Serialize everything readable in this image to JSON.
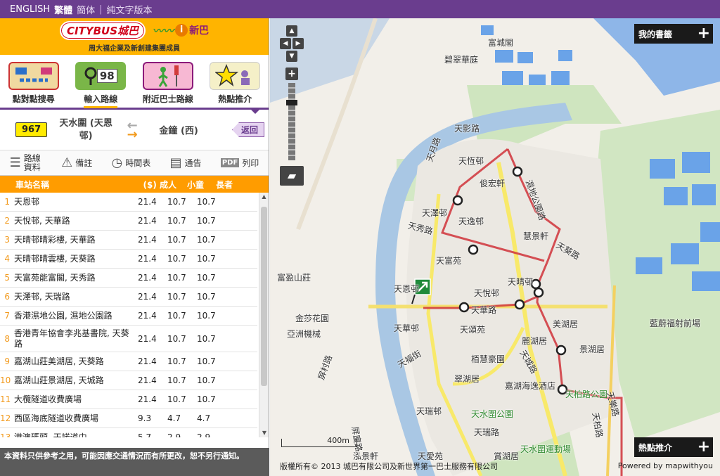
{
  "langbar": {
    "english": "ENGLISH",
    "trad": "繁體",
    "simp": "簡体",
    "text_version": "純文字版本"
  },
  "logo": {
    "citybus": "CITYBUS城巴",
    "firstbus": "新巴",
    "tagline": "周大福企業及新創建集團成員"
  },
  "tabs": [
    {
      "label": "點對點搜尋"
    },
    {
      "label": "輸入路線",
      "number": "98"
    },
    {
      "label": "附近巴士路線"
    },
    {
      "label": "熱點推介"
    }
  ],
  "route": {
    "number": "967",
    "from": "天水圍 (天恩邨)",
    "to": "金鐘 (西)",
    "back": "返回"
  },
  "toolbar": {
    "info": "路線資料",
    "remarks": "備註",
    "timetable": "時間表",
    "notice": "通告",
    "print": "列印"
  },
  "table": {
    "headers": {
      "stop": "車站名稱",
      "adult": "($) 成人",
      "child": "小童",
      "senior": "長者"
    },
    "rows": [
      {
        "n": "1",
        "name": "天恩邨",
        "a": "21.4",
        "b": "10.7",
        "c": "10.7"
      },
      {
        "n": "2",
        "name": "天悅邨, 天華路",
        "a": "21.4",
        "b": "10.7",
        "c": "10.7"
      },
      {
        "n": "3",
        "name": "天晴邨晴彩樓, 天華路",
        "a": "21.4",
        "b": "10.7",
        "c": "10.7"
      },
      {
        "n": "4",
        "name": "天晴邨晴雲樓, 天葵路",
        "a": "21.4",
        "b": "10.7",
        "c": "10.7"
      },
      {
        "n": "5",
        "name": "天富苑能富閣, 天秀路",
        "a": "21.4",
        "b": "10.7",
        "c": "10.7"
      },
      {
        "n": "6",
        "name": "天澤邨, 天瑞路",
        "a": "21.4",
        "b": "10.7",
        "c": "10.7"
      },
      {
        "n": "7",
        "name": "香港濕地公園, 濕地公園路",
        "a": "21.4",
        "b": "10.7",
        "c": "10.7"
      },
      {
        "n": "8",
        "name": "香港青年協會李兆基書院, 天葵路",
        "a": "21.4",
        "b": "10.7",
        "c": "10.7"
      },
      {
        "n": "9",
        "name": "嘉湖山莊美湖居, 天葵路",
        "a": "21.4",
        "b": "10.7",
        "c": "10.7"
      },
      {
        "n": "10",
        "name": "嘉湖山莊景湖居, 天城路",
        "a": "21.4",
        "b": "10.7",
        "c": "10.7"
      },
      {
        "n": "11",
        "name": "大欖隧道收費廣場",
        "a": "21.4",
        "b": "10.7",
        "c": "10.7"
      },
      {
        "n": "12",
        "name": "西區海底隧道收費廣場",
        "a": "9.3",
        "b": "4.7",
        "c": "4.7"
      },
      {
        "n": "13",
        "name": "港澳碼頭, 干諾道中",
        "a": "5.7",
        "b": "2.9",
        "c": "2.9"
      }
    ]
  },
  "footer_note": "本資料只供參考之用，可能因應交通情況而有所更改，恕不另行通知。",
  "map": {
    "bookmark": "我的書籤",
    "hot": "熱點推介",
    "scale": "400m",
    "copyright": "版權所有© 2013 城巴有限公司及新世界第一巴士服務有限公司",
    "powered": "Powered by mapwithyou",
    "labels": {
      "fucheng": "富城閣",
      "bicui": "碧翠華庭",
      "tianying": "天影路",
      "tianyue_rd": "天月路",
      "tianheng": "天恆邨",
      "junzhai": "俊宏軒",
      "wetland_rd": "濕地公園路",
      "tianze": "天澤邨",
      "tianyi": "天逸邨",
      "tianxiu": "天秀路",
      "huijing": "慧景軒",
      "tiankui": "天葵路",
      "tianfu": "天富苑",
      "fugao": "富盈山莊",
      "tianqing": "天晴邨",
      "tianyue_est": "天悅邨",
      "tianen": "天恩邨",
      "tianhua_rd": "天華路",
      "jinsha": "金莎花園",
      "yazhou": "亞洲機械",
      "tianhua_est": "天華邨",
      "tiansong": "天頌苑",
      "lihu": "麗湖居",
      "meihu": "美湖居",
      "jinghu": "景湖居",
      "lanting": "藍蔚福射前場",
      "tiancheng_rd": "天城路",
      "tianfu_st": "天福街",
      "baihui": "栢慧豪園",
      "cuihu": "翠湖居",
      "jiahu": "嘉湖海逸酒店",
      "tianbai": "天柏路公園",
      "tswpark": "天水圍公園",
      "tianrui": "天瑞邨",
      "tianrui_rd": "天瑞路",
      "tianbai_rd": "天柏路",
      "pingyu": "屏廈路",
      "hongqu": "泓景軒",
      "tianai": "天愛苑",
      "shanghu": "賞湖居",
      "sportsground": "天水圍運動場",
      "pingcheng": "屏村路",
      "tianle": "天樂路"
    }
  }
}
